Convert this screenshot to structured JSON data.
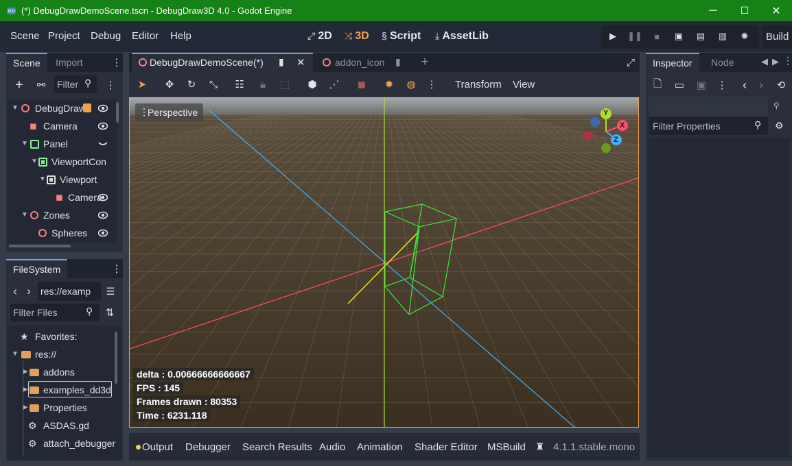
{
  "window": {
    "title": "(*) DebugDrawDemoScene.tscn - DebugDraw3D 4.0 - Godot Engine",
    "minimize": "─",
    "maximize": "☐",
    "close": "✕"
  },
  "menu": {
    "items": [
      "Scene",
      "Project",
      "Debug",
      "Editor",
      "Help"
    ]
  },
  "workspaces": {
    "2d": "2D",
    "3d": "3D",
    "script": "Script",
    "assetlib": "AssetLib"
  },
  "build_label": "Build",
  "scene_dock": {
    "tabs": [
      "Scene",
      "Import"
    ],
    "filter_placeholder": "Filter",
    "nodes": [
      {
        "name": "DebugDraw",
        "icon": "node3d-icon",
        "color": "#fc7f7f"
      },
      {
        "name": "Camera",
        "icon": "camera-icon",
        "color": "#fc7f7f"
      },
      {
        "name": "Panel",
        "icon": "control-icon",
        "color": "#8eef97"
      },
      {
        "name": "ViewportCon",
        "icon": "viewport-container-icon",
        "color": "#8eef97"
      },
      {
        "name": "Viewport",
        "icon": "viewport-icon",
        "color": "#e0e0e0"
      },
      {
        "name": "Camera",
        "icon": "camera-icon",
        "color": "#fc7f7f"
      },
      {
        "name": "Zones",
        "icon": "node3d-icon",
        "color": "#fc7f7f"
      },
      {
        "name": "Spheres",
        "icon": "node3d-icon",
        "color": "#fc7f7f"
      }
    ]
  },
  "filesystem": {
    "tab": "FileSystem",
    "path": "res://examp",
    "filter_placeholder": "Filter Files",
    "items": [
      {
        "label": "Favorites:",
        "icon": "star-icon"
      },
      {
        "label": "res://",
        "icon": "folder-icon"
      },
      {
        "label": "addons",
        "icon": "folder-icon"
      },
      {
        "label": "examples_dd3d",
        "icon": "folder-icon"
      },
      {
        "label": "Properties",
        "icon": "folder-icon"
      },
      {
        "label": "ASDAS.gd",
        "icon": "gear-icon"
      },
      {
        "label": "attach_debugger",
        "icon": "gear-icon"
      }
    ]
  },
  "editor_tabs": [
    {
      "label": "DebugDrawDemoScene(*)",
      "active": true
    },
    {
      "label": "addon_icon",
      "active": false
    }
  ],
  "toolbar": {
    "transform": "Transform",
    "view": "View"
  },
  "viewport": {
    "perspective": "Perspective",
    "gizmo": {
      "y": "Y",
      "x": "X",
      "z": "Z"
    },
    "stats": {
      "delta": "delta : 0.00666666666667",
      "fps": "FPS : 145",
      "frames": "Frames drawn : 80353",
      "time": "Time : 6231.118"
    }
  },
  "bottom_panel": {
    "tabs": [
      "Output",
      "Debugger",
      "Search Results",
      "Audio",
      "Animation",
      "Shader Editor",
      "MSBuild"
    ],
    "version": "4.1.1.stable.mono"
  },
  "inspector": {
    "tabs": [
      "Inspector",
      "Node"
    ],
    "filter_placeholder": "Filter Properties"
  },
  "colors": {
    "accent": "#f5a04b",
    "titlebar": "#168116",
    "panel": "#2a2f3b",
    "background": "#363d4a"
  }
}
